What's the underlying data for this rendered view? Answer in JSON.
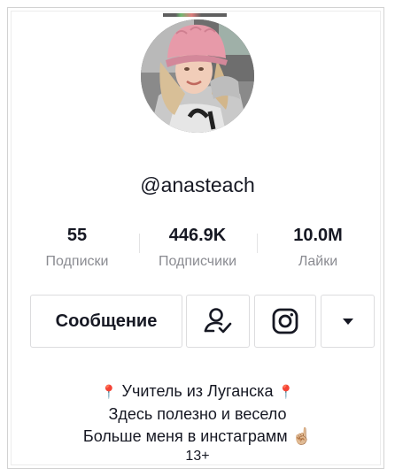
{
  "profile": {
    "username": "@anasteach",
    "avatar_icon": "profile-photo",
    "stats": [
      {
        "value": "55",
        "label": "Подписки"
      },
      {
        "value": "446.9K",
        "label": "Подписчики"
      },
      {
        "value": "10.0M",
        "label": "Лайки"
      }
    ]
  },
  "actions": {
    "message_label": "Сообщение",
    "follow_icon": "user-check-icon",
    "instagram_icon": "instagram-icon",
    "more_icon": "caret-down-icon"
  },
  "bio": {
    "line1_text": "Учитель из Луганска",
    "line1_pin": "📍",
    "line2": "Здесь полезно и весело",
    "line3_text": "Больше меня в инстаграмм",
    "line3_emoji": "☝🏼",
    "age": "13+"
  },
  "colors": {
    "text": "#161823",
    "secondary": "#8a8b91",
    "border": "#dcdcde",
    "pin": "#e0313f"
  }
}
